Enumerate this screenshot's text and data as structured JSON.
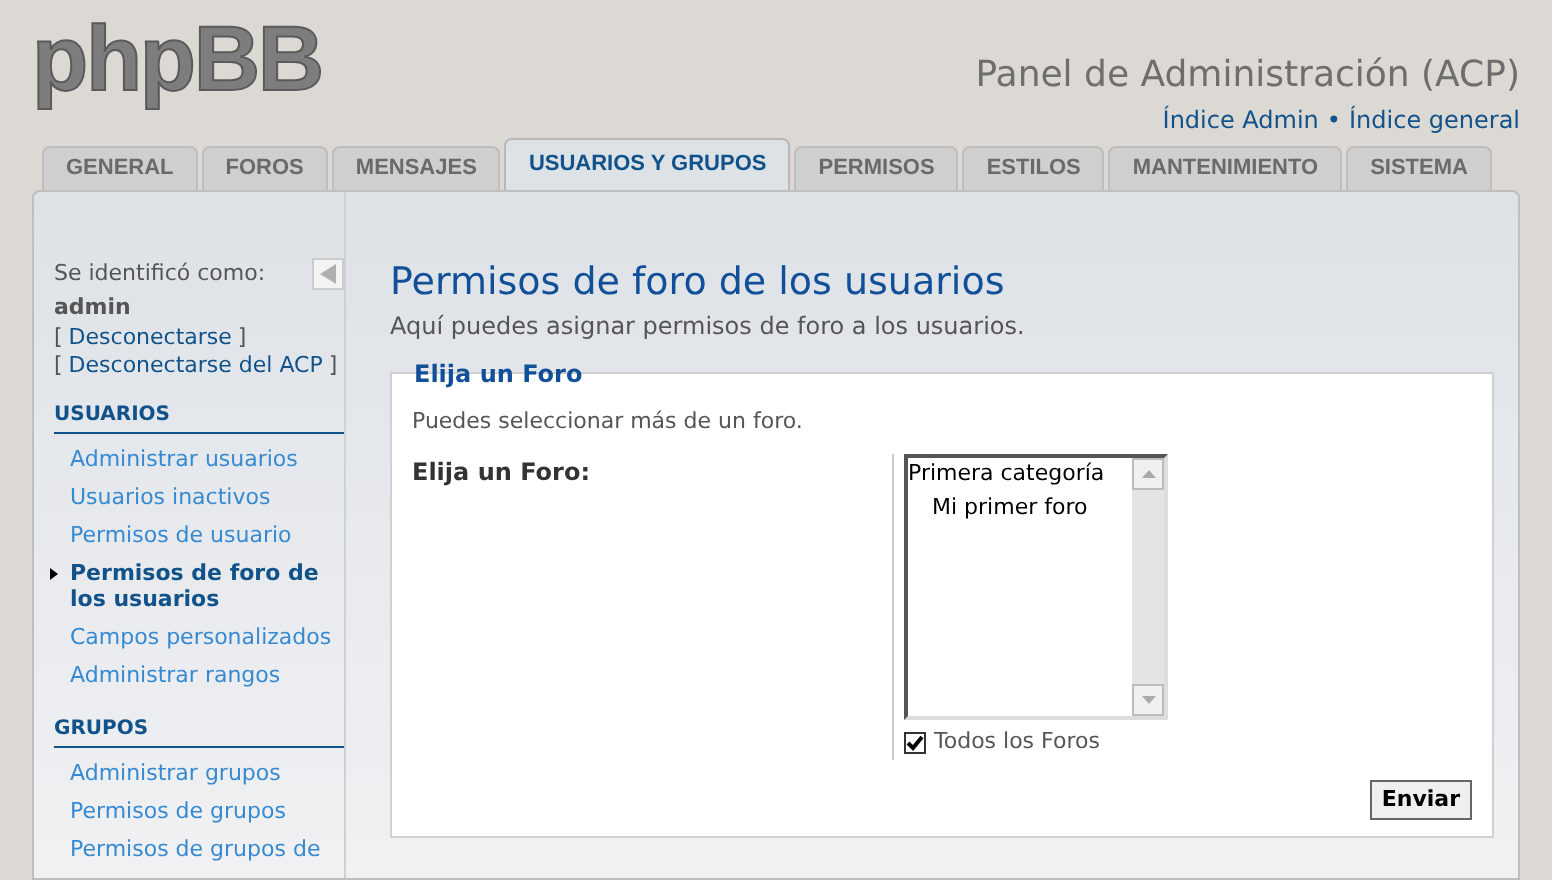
{
  "logo": "phpBB",
  "header": {
    "title": "Panel de Administración (ACP)",
    "links": [
      "Índice Admin",
      "Índice general"
    ],
    "separator": "•"
  },
  "tabs": [
    {
      "label": "GENERAL",
      "selected": false
    },
    {
      "label": "FOROS",
      "selected": false
    },
    {
      "label": "MENSAJES",
      "selected": false
    },
    {
      "label": "USUARIOS Y GRUPOS",
      "selected": true
    },
    {
      "label": "PERMISOS",
      "selected": false
    },
    {
      "label": "ESTILOS",
      "selected": false
    },
    {
      "label": "MANTENIMIENTO",
      "selected": false
    },
    {
      "label": "SISTEMA",
      "selected": false
    }
  ],
  "sidebar": {
    "logged_as": "Se identificó como:",
    "user": "admin",
    "logout_links": [
      "Desconectarse",
      "Desconectarse del ACP"
    ],
    "bracket_open": "[",
    "bracket_close": "]",
    "sections": [
      {
        "title": "USUARIOS",
        "items": [
          {
            "label": "Administrar usuarios",
            "selected": false
          },
          {
            "label": "Usuarios inactivos",
            "selected": false
          },
          {
            "label": "Permisos de usuario",
            "selected": false
          },
          {
            "label": "Permisos de foro de los usuarios",
            "selected": true
          },
          {
            "label": "Campos personalizados",
            "selected": false
          },
          {
            "label": "Administrar rangos",
            "selected": false
          }
        ]
      },
      {
        "title": "GRUPOS",
        "items": [
          {
            "label": "Administrar grupos",
            "selected": false
          },
          {
            "label": "Permisos de grupos",
            "selected": false
          },
          {
            "label": "Permisos de grupos de",
            "selected": false
          }
        ]
      }
    ]
  },
  "main": {
    "title": "Permisos de foro de los usuarios",
    "description": "Aquí puedes asignar permisos de foro a los usuarios.",
    "fieldset": {
      "legend": "Elija un Foro",
      "hint": "Puedes seleccionar más de un foro.",
      "label": "Elija un Foro:",
      "options": [
        {
          "label": "Primera categoría",
          "children": [
            {
              "label": "Mi primer foro"
            }
          ]
        }
      ],
      "all_forums": {
        "label": "Todos los Foros",
        "checked": true
      },
      "submit": "Enviar"
    }
  }
}
